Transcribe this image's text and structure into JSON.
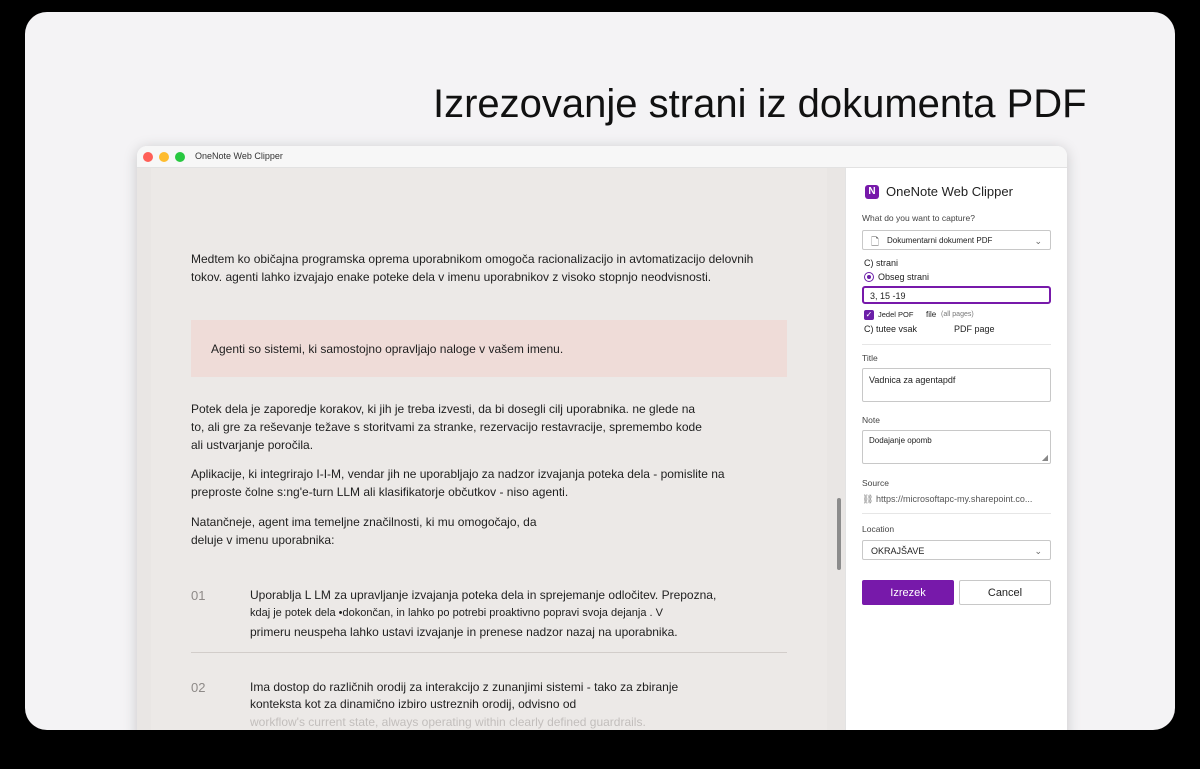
{
  "headline": "Izrezovanje strani iz dokumenta PDF",
  "window": {
    "title": "OneNote Web Clipper"
  },
  "doc": {
    "para1": [
      "Medtem ko običajna programska oprema uporabnikom omogoča racionalizacijo in avtomatizacijo delovnih",
      "tokov. agenti lahko izvajajo enake poteke dela v imenu uporabnikov z visoko stopnjo neodvisnosti."
    ],
    "callout": "Agenti so sistemi, ki samostojno opravljajo naloge v vašem imenu.",
    "para2": [
      "Potek dela je zaporedje korakov, ki jih je treba izvesti, da bi dosegli cilj uporabnika. ne glede na",
      "to, ali gre za reševanje težave s storitvami za stranke, rezervacijo restavracije, spremembo kode",
      "ali ustvarjanje poročila."
    ],
    "para3": [
      "Aplikacije, ki integrirajo I-I-M, vendar jih ne uporabljajo za nadzor izvajanja poteka dela - pomislite na",
      "preproste čolne s:ng'e-turn LLM ali klasifikatorje občutkov - niso agenti."
    ],
    "para4": [
      "Natančneje, agent ima temeljne značilnosti, ki mu omogočajo, da",
      "deluje v imenu uporabnika:"
    ],
    "item1": {
      "num": "01",
      "lines": [
        "Uporablja L LM za upravljanje izvajanja poteka dela in sprejemanje odločitev. Prepozna,",
        "kdaj je potek dela •dokončan, in lahko po potrebi proaktivno popravi svoja dejanja . V",
        "primeru neuspeha lahko ustavi izvajanje in prenese nadzor nazaj na uporabnika."
      ]
    },
    "item2": {
      "num": "02",
      "lines": [
        "Ima dostop do različnih orodij za interakcijo z zunanjimi sistemi - tako za zbiranje",
        "konteksta kot za dinamično izbiro ustreznih orodij, odvisno od",
        "workflow's current state, always operating within clearly defined guardrails."
      ]
    }
  },
  "panel": {
    "title": "OneNote Web Clipper",
    "capture_label": "What do you want to capture?",
    "capture_value": "Dokumentarni dokument PDF",
    "option_pages": "C) strani",
    "option_range": "Obseg strani",
    "range_value": "3, 15 -19",
    "checkbox_label": "Jedel POF",
    "checkbox_file": "file",
    "checkbox_hint": "(all pages)",
    "option_each": "C) tutee vsak",
    "option_each_suffix": "PDF page",
    "title_label": "Title",
    "title_value": "Vadnica za agentapdf",
    "note_label": "Note",
    "note_value": "Dodajanje opomb",
    "source_label": "Source",
    "source_value": "https://microsoftapc-my.sharepoint.co...",
    "location_label": "Location",
    "location_value": "OKRAJŠAVE",
    "clip_button": "Izrezek",
    "cancel_button": "Cancel"
  },
  "colors": {
    "accent": "#7719aa",
    "callout_bg": "#efdcd8"
  }
}
